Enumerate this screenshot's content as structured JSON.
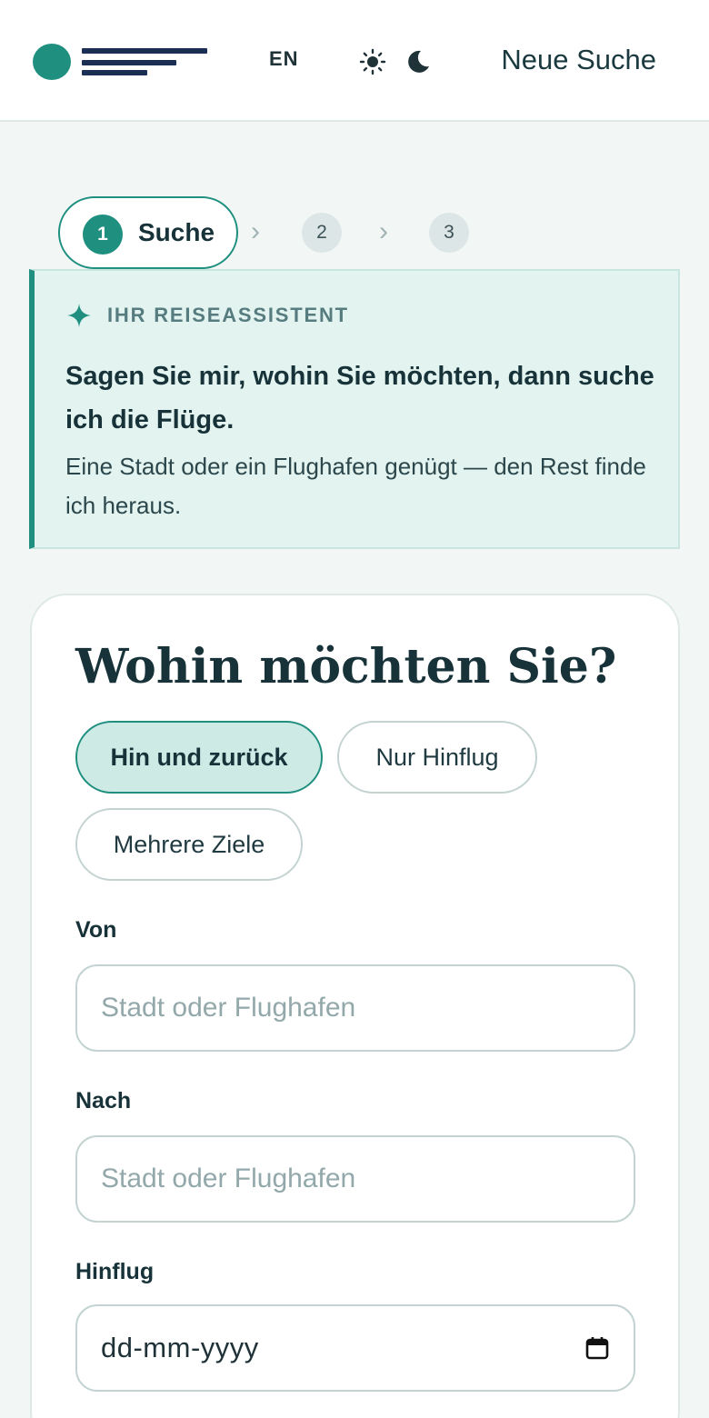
{
  "header": {
    "logo_icon": "brand-logo-mark",
    "lang_label": "EN",
    "theme_icons": [
      "sun-icon",
      "moon-icon"
    ],
    "new_search_label": "Neue Suche"
  },
  "stepper": {
    "active": {
      "number": "1",
      "label": "Suche"
    },
    "steps": [
      "2",
      "3"
    ],
    "separator": "›"
  },
  "assistant": {
    "icon": "sparkle-icon",
    "tag": "IHR REISEASSISTENT",
    "title": "Sagen Sie mir, wohin Sie möchten, dann suche ich die Flüge.",
    "text": "Eine Stadt oder ein Flughafen genügt — den Rest finde ich heraus."
  },
  "form": {
    "title": "Wohin möchten Sie?",
    "trip_types": [
      {
        "label": "Hin und zurück",
        "selected": true
      },
      {
        "label": "Nur Hinflug",
        "selected": false
      },
      {
        "label": "Mehrere Ziele",
        "selected": false
      }
    ],
    "from": {
      "label": "Von",
      "placeholder": "Stadt oder Flughafen",
      "value": ""
    },
    "to": {
      "label": "Nach",
      "placeholder": "Stadt oder Flughafen",
      "value": ""
    },
    "depart": {
      "label": "Hinflug",
      "placeholder": "dd-mm-yyyy",
      "icon": "calendar-icon"
    }
  },
  "colors": {
    "accent": "#1f8f80",
    "brand_navy": "#1b2f55",
    "page_bg": "#f2f7f6",
    "assistant_bg": "#e3f3ef",
    "selected_pill_bg": "#cdeae5",
    "text": "#173238"
  }
}
